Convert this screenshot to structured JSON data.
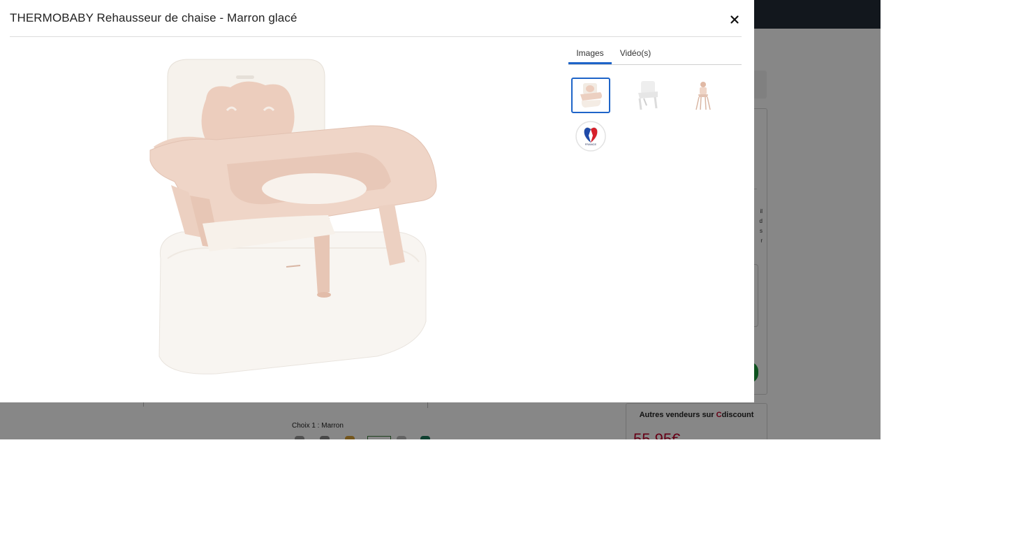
{
  "modal": {
    "title": "THERMOBABY Rehausseur de chaise - Marron glacé",
    "close_glyph": "×",
    "tabs": [
      {
        "label": "Images",
        "active": true
      },
      {
        "label": "Vidéo(s)",
        "active": false
      }
    ],
    "thumbnails": [
      {
        "subject": "booster-seat-beige",
        "selected": true
      },
      {
        "subject": "booster-seat-on-chair",
        "selected": false
      },
      {
        "subject": "booster-seat-on-high-chair",
        "selected": false
      },
      {
        "subject": "made-in-france-badge",
        "selected": false,
        "badge_text": "FRANCE"
      }
    ],
    "accent_color": "#1e64c8"
  },
  "background_page": {
    "side_text": "il\nd\ns\nr",
    "vendors_title_prefix": "Autres vendeurs sur ",
    "vendors_title_brand": "C",
    "vendors_title_suffix": "discount",
    "vendor_price": "55,95€",
    "choice_label": "Choix 1 : ",
    "choice_value": "Marron",
    "red_note": "€ ........"
  },
  "colors": {
    "topbar": "#222c38",
    "overlay": "rgba(0,0,0,0.47)",
    "brand_red": "#c0002a",
    "product_pink": "#eccdbd",
    "product_cream": "#f7f3ee"
  },
  "icons": {
    "close": "close-icon",
    "main_image": "booster-seat-image"
  }
}
